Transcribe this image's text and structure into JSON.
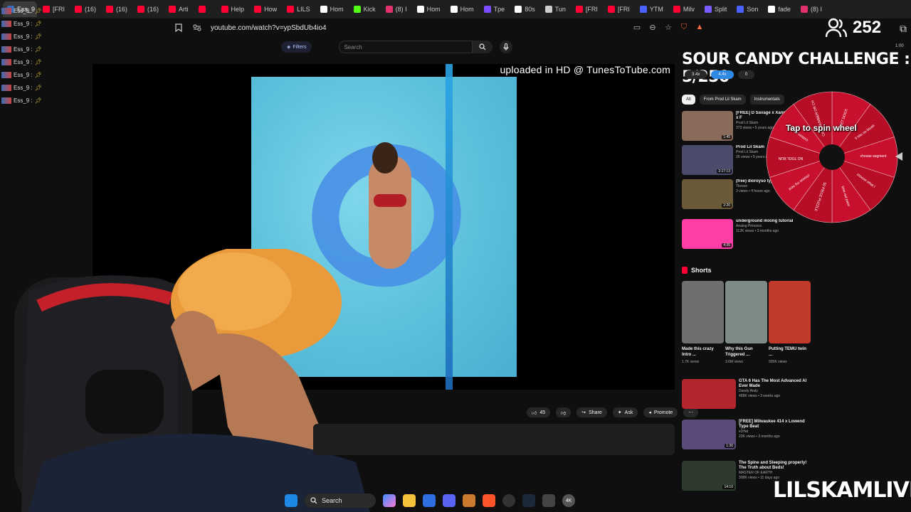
{
  "browser": {
    "tabs": [
      {
        "label": "Ess_9 |",
        "color": "#3b6db5",
        "active": true
      },
      {
        "label": "[FRI",
        "color": "#ff0033"
      },
      {
        "label": "(16)",
        "color": "#ff0033"
      },
      {
        "label": "(16)",
        "color": "#ff0033"
      },
      {
        "label": "(16)",
        "color": "#ff0033"
      },
      {
        "label": "Arti",
        "color": "#ff0033"
      },
      {
        "label": "",
        "color": "#ff0033"
      },
      {
        "label": "Help",
        "color": "#ff0033"
      },
      {
        "label": "How",
        "color": "#ff0033"
      },
      {
        "label": "LILS",
        "color": "#ff0033"
      },
      {
        "label": "Hom",
        "color": "#ffffff"
      },
      {
        "label": "Kick",
        "color": "#53fc18"
      },
      {
        "label": "(8) I",
        "color": "#e1306c"
      },
      {
        "label": "Hom",
        "color": "#ffffff"
      },
      {
        "label": "Hom",
        "color": "#ffffff"
      },
      {
        "label": "Tpe",
        "color": "#7c4dff"
      },
      {
        "label": "80s",
        "color": "#ffffff"
      },
      {
        "label": "Tun",
        "color": "#cccccc"
      },
      {
        "label": "[FRI",
        "color": "#ff0033"
      },
      {
        "label": "[FRI",
        "color": "#ff0033"
      },
      {
        "label": "YTM",
        "color": "#4a62ff"
      },
      {
        "label": "Milv",
        "color": "#ff0033"
      },
      {
        "label": "Split",
        "color": "#7b5cff"
      },
      {
        "label": "Son",
        "color": "#4a62ff"
      },
      {
        "label": "fade",
        "color": "#ffffff"
      },
      {
        "label": "(8) I",
        "color": "#e1306c"
      }
    ],
    "url": "youtube.com/watch?v=ypSbdUb4io4"
  },
  "viewers": {
    "count": "252"
  },
  "side_list": {
    "items": [
      {
        "label": "Ess_9 :"
      },
      {
        "label": "Ess_9 :"
      },
      {
        "label": "Ess_9 :"
      },
      {
        "label": "Ess_9 :"
      },
      {
        "label": "Ess_9 :"
      },
      {
        "label": "Ess_9 :"
      },
      {
        "label": "Ess_9 :"
      },
      {
        "label": "Ess_9 :"
      }
    ]
  },
  "youtube": {
    "filters_label": "Filters",
    "search_placeholder": "Search",
    "video_caption": "uploaded in HD @ TunesToTube.com",
    "actions": {
      "likes": "45",
      "share": "Share",
      "ask": "Ask",
      "promote": "Promote"
    }
  },
  "challenge": {
    "title": "SOUR CANDY CHALLENGE : 5/250"
  },
  "speed_chips": [
    "3.4x",
    "4.4x",
    "0"
  ],
  "filter_chips": [
    "All",
    "From Prod Lil Skam",
    "Instrumentals"
  ],
  "recommendations": [
    {
      "title": "[FREE] D Savage x XanmanShawty x F",
      "channel": "Prod Lil Skam",
      "stats": "373 views • 5 years ago",
      "duration": "1:45",
      "color": "#8a6a5a"
    },
    {
      "title": "Prod Lil Skam",
      "channel": "Prod Lil Skam",
      "stats": "26 views • 5 years ago",
      "duration": "2:17:13",
      "color": "#4b4b6b"
    },
    {
      "title": "(free) dioroyso type beat (prod.",
      "channel": "Tkosse",
      "stats": "3 views • 4 hours ago",
      "duration": "2:20",
      "color": "#6b5a3a"
    },
    {
      "title": "underground mixing tutorial",
      "channel": "Analog Princess",
      "stats": "112K views • 3 months ago",
      "duration": "4:35",
      "color": "#ff3ea5"
    }
  ],
  "shorts": {
    "heading": "Shorts",
    "items": [
      {
        "title": "Made this crazy Intro ...",
        "views": "1.7K views",
        "color": "#6f6f6f"
      },
      {
        "title": "Why this Gun Triggered ...",
        "views": "3.6M views",
        "color": "#7d8b86"
      },
      {
        "title": "Putting TEMU twin ...",
        "views": "935K views",
        "color": "#c0392b"
      }
    ]
  },
  "recommendations2": [
    {
      "title": "GTA 6 Has The Most Advanced AI Ever Made",
      "channel": "Dandy Andy",
      "stats": "458K views • 3 weeks ago",
      "duration": "",
      "color": "#b3262e"
    },
    {
      "title": "[FREE] Milwaukee 414 x Lowend Type Beat",
      "channel": "x1Hat",
      "stats": "23K views • 3 months ago",
      "duration": "1:30",
      "color": "#5a4a7a"
    },
    {
      "title": "The Spine and Sleeping properly! The Truth about Beds!",
      "channel": "MASTER OF EARTH",
      "stats": "308K views • 11 days ago",
      "duration": "14:10",
      "color": "#2e3a2e"
    }
  ],
  "wheel": {
    "label": "Tap to spin wheel",
    "segments": [
      "LET DOGS",
      "5 hits no brush",
      "choose segment",
      "choose what I",
      "time out pass",
      "50 PIECE PUZZLE",
      "choose my next",
      "NO TOOL RUN",
      "custom answer",
      "CALL NUMBER OR CH"
    ],
    "color": "#c8102e"
  },
  "taskbar": {
    "search_label": "Search"
  },
  "brand": {
    "name": "LILSKAMLIVE"
  },
  "stream_time": "1:00"
}
